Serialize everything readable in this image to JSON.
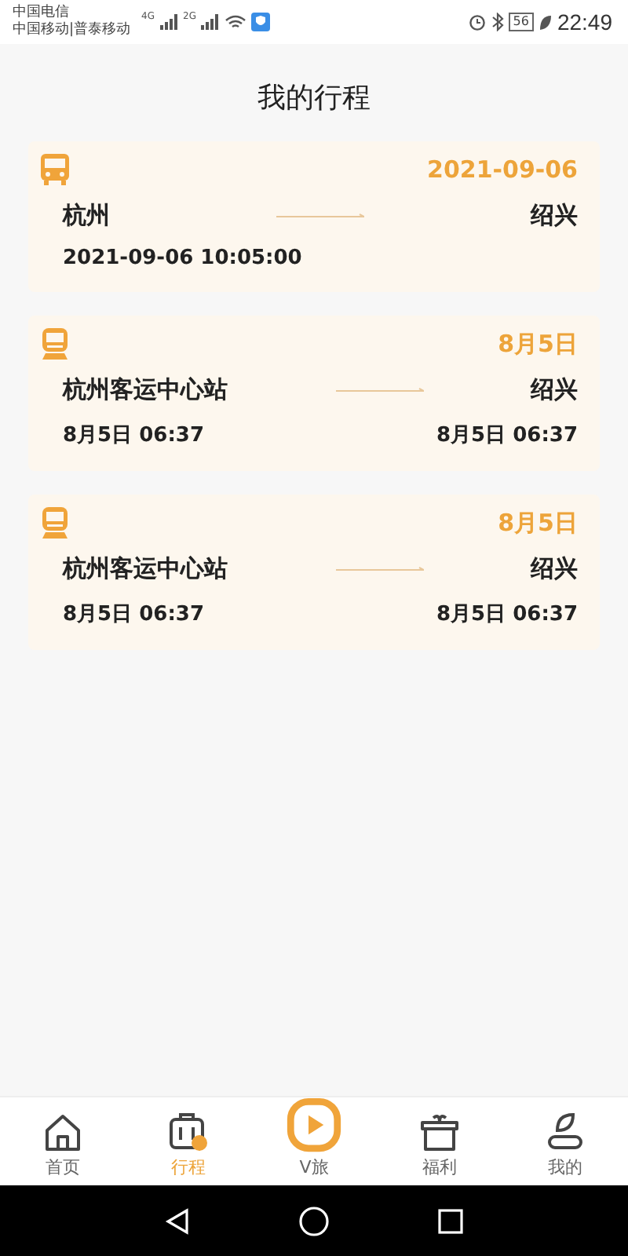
{
  "status_bar": {
    "carrier_1": "中国电信",
    "carrier_2": "中国移动|普泰移动",
    "network_1": "4G",
    "network_2": "2G",
    "battery": "56",
    "time": "22:49"
  },
  "title": "我的行程",
  "trips": [
    {
      "kind": "bus",
      "date": "2021-09-06",
      "from": "杭州",
      "to": "绍兴",
      "depart_time": "2021-09-06 10:05:00"
    },
    {
      "kind": "train",
      "date": "8月5日",
      "from": "杭州客运中心站",
      "to": "绍兴",
      "depart_time": "8月5日 06:37",
      "arrive_time": "8月5日 06:37"
    },
    {
      "kind": "train",
      "date": "8月5日",
      "from": "杭州客运中心站",
      "to": "绍兴",
      "depart_time": "8月5日 06:37",
      "arrive_time": "8月5日 06:37"
    }
  ],
  "tabs": [
    {
      "kind": "home",
      "label": "首页",
      "selected": false
    },
    {
      "kind": "luggage",
      "label": "行程",
      "selected": true
    },
    {
      "kind": "play",
      "label": "V旅",
      "selected": false
    },
    {
      "kind": "gift",
      "label": "福利",
      "selected": false
    },
    {
      "kind": "user",
      "label": "我的",
      "selected": false
    }
  ]
}
